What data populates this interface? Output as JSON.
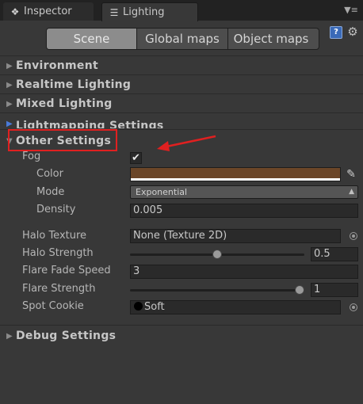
{
  "tabs": [
    {
      "icon": "info-icon",
      "label": "Inspector"
    },
    {
      "icon": "lighting-icon",
      "label": "Lighting"
    }
  ],
  "toolbar": {
    "segments": [
      "Scene",
      "Global maps",
      "Object maps"
    ],
    "active": "Scene"
  },
  "sections": {
    "environment": "Environment",
    "realtime": "Realtime Lighting",
    "mixed": "Mixed Lighting",
    "lightmapping": "Lightmapping Settings",
    "other": "Other Settings",
    "debug": "Debug Settings"
  },
  "fog": {
    "label": "Fog",
    "enabled": true,
    "check_glyph": "✔",
    "color_label": "Color",
    "color_value": "#6b4628",
    "mode_label": "Mode",
    "mode_value": "Exponential",
    "density_label": "Density",
    "density_value": "0.005"
  },
  "halo": {
    "texture_label": "Halo Texture",
    "texture_value": "None (Texture 2D)",
    "strength_label": "Halo Strength",
    "strength_value": "0.5",
    "strength_fraction": 0.5
  },
  "flare": {
    "fade_label": "Flare Fade Speed",
    "fade_value": "3",
    "strength_label": "Flare Strength",
    "strength_value": "1",
    "strength_fraction": 1.0
  },
  "spot_cookie": {
    "label": "Spot Cookie",
    "value": "Soft"
  },
  "colors": {
    "panel": "#383838",
    "highlight_box": "#e02020",
    "annotation_arrow": "#e02020"
  }
}
